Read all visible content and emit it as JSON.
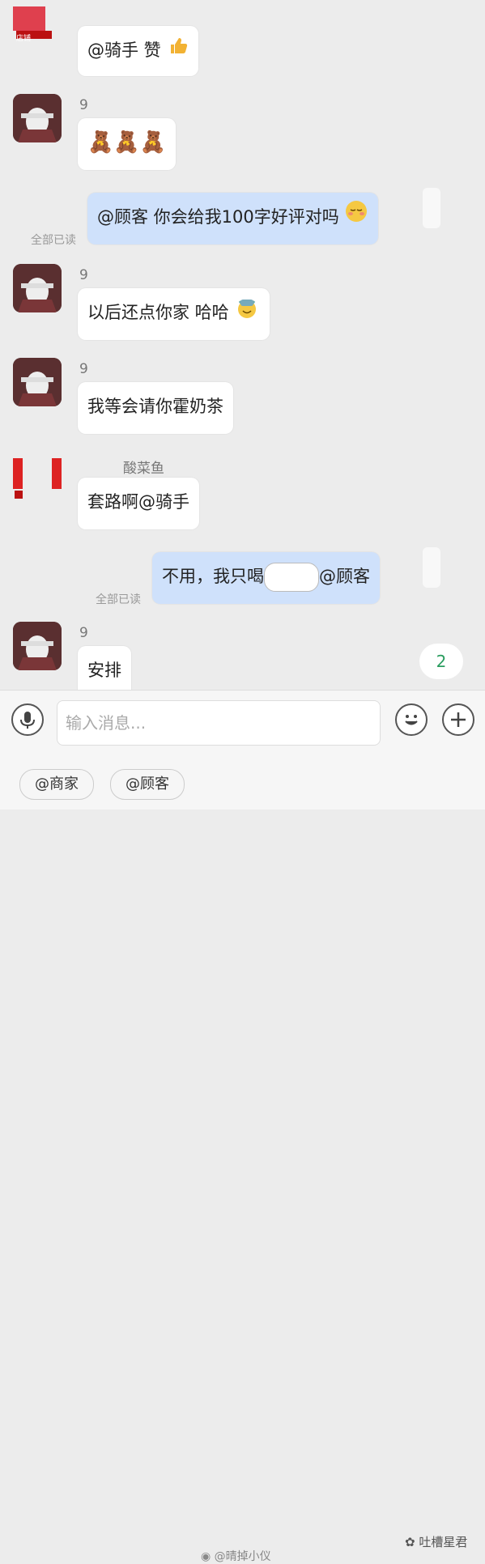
{
  "messages": [
    {
      "text": "@骑手 赞"
    },
    {
      "sender": "9",
      "text": "🧸🧸🧸"
    },
    {
      "text": "@顾客 你会给我100字好评对吗",
      "read": "全部已读"
    },
    {
      "sender": "9",
      "text": "以后还点你家 哈哈"
    },
    {
      "sender": "9",
      "text": "我等会请你霍奶茶"
    },
    {
      "sender": "酸菜鱼",
      "text": "套路啊@骑手"
    },
    {
      "text_prefix": "不用，我只喝",
      "text_suffix": "@顾客",
      "read": "全部已读"
    },
    {
      "sender": "9",
      "text": "安排"
    }
  ],
  "unread_count": "2",
  "input": {
    "placeholder": "输入消息..."
  },
  "mentions": [
    {
      "label": "@商家"
    },
    {
      "label": "@顾客"
    }
  ],
  "watermarks": {
    "weibo": "@晴掉小仪",
    "wechat": "吐槽星君"
  },
  "colors": {
    "my_bubble": "#cfe1fb",
    "other_bubble": "#ffffff",
    "badge_text": "#2a9d5f"
  }
}
